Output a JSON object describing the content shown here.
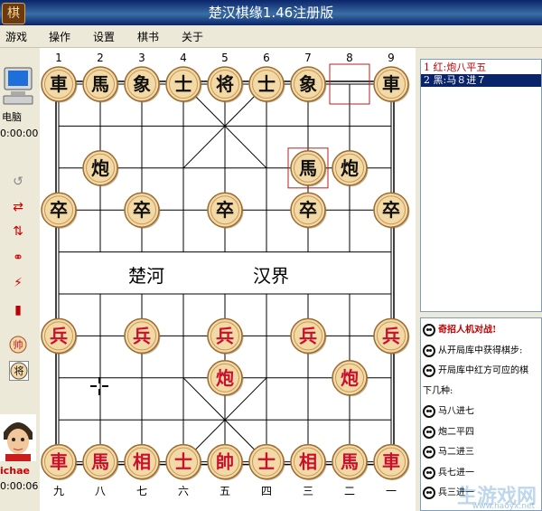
{
  "window": {
    "title": "楚汉棋缘1.46注册版",
    "icon_char": "棋"
  },
  "menu": [
    "游戏",
    "操作",
    "设置",
    "棋书",
    "关于"
  ],
  "top_player": {
    "name": "电脑",
    "time": "0:00:00"
  },
  "bottom_player": {
    "name": "ichae",
    "time": "0:00:06"
  },
  "river": {
    "left": "楚河",
    "right": "汉界"
  },
  "column_labels_top": [
    "1",
    "2",
    "3",
    "4",
    "5",
    "6",
    "7",
    "8",
    "9"
  ],
  "column_labels_bottom": [
    "九",
    "八",
    "七",
    "六",
    "五",
    "四",
    "三",
    "二",
    "一"
  ],
  "pieces": [
    {
      "c": 0,
      "r": 0,
      "ch": "車",
      "side": "black"
    },
    {
      "c": 1,
      "r": 0,
      "ch": "馬",
      "side": "black"
    },
    {
      "c": 2,
      "r": 0,
      "ch": "象",
      "side": "black"
    },
    {
      "c": 3,
      "r": 0,
      "ch": "士",
      "side": "black"
    },
    {
      "c": 4,
      "r": 0,
      "ch": "将",
      "side": "black"
    },
    {
      "c": 5,
      "r": 0,
      "ch": "士",
      "side": "black"
    },
    {
      "c": 6,
      "r": 0,
      "ch": "象",
      "side": "black"
    },
    {
      "c": 8,
      "r": 0,
      "ch": "車",
      "side": "black"
    },
    {
      "c": 1,
      "r": 2,
      "ch": "炮",
      "side": "black"
    },
    {
      "c": 6,
      "r": 2,
      "ch": "馬",
      "side": "black"
    },
    {
      "c": 7,
      "r": 2,
      "ch": "炮",
      "side": "black"
    },
    {
      "c": 0,
      "r": 3,
      "ch": "卒",
      "side": "black"
    },
    {
      "c": 2,
      "r": 3,
      "ch": "卒",
      "side": "black"
    },
    {
      "c": 4,
      "r": 3,
      "ch": "卒",
      "side": "black"
    },
    {
      "c": 6,
      "r": 3,
      "ch": "卒",
      "side": "black"
    },
    {
      "c": 8,
      "r": 3,
      "ch": "卒",
      "side": "black"
    },
    {
      "c": 0,
      "r": 6,
      "ch": "兵",
      "side": "red"
    },
    {
      "c": 2,
      "r": 6,
      "ch": "兵",
      "side": "red"
    },
    {
      "c": 4,
      "r": 6,
      "ch": "兵",
      "side": "red"
    },
    {
      "c": 6,
      "r": 6,
      "ch": "兵",
      "side": "red"
    },
    {
      "c": 8,
      "r": 6,
      "ch": "兵",
      "side": "red"
    },
    {
      "c": 4,
      "r": 7,
      "ch": "炮",
      "side": "red"
    },
    {
      "c": 7,
      "r": 7,
      "ch": "炮",
      "side": "red"
    },
    {
      "c": 0,
      "r": 9,
      "ch": "車",
      "side": "red"
    },
    {
      "c": 1,
      "r": 9,
      "ch": "馬",
      "side": "red"
    },
    {
      "c": 2,
      "r": 9,
      "ch": "相",
      "side": "red"
    },
    {
      "c": 3,
      "r": 9,
      "ch": "士",
      "side": "red"
    },
    {
      "c": 4,
      "r": 9,
      "ch": "帥",
      "side": "red"
    },
    {
      "c": 5,
      "r": 9,
      "ch": "士",
      "side": "red"
    },
    {
      "c": 6,
      "r": 9,
      "ch": "相",
      "side": "red"
    },
    {
      "c": 7,
      "r": 9,
      "ch": "馬",
      "side": "red"
    },
    {
      "c": 8,
      "r": 9,
      "ch": "車",
      "side": "red"
    }
  ],
  "last_move": {
    "from": {
      "c": 7,
      "r": 0
    },
    "to": {
      "c": 6,
      "r": 2
    }
  },
  "moves": [
    {
      "text": "1  红:炮八平五",
      "color": "#c00000",
      "selected": false
    },
    {
      "text": "2  黑:马８进７",
      "color": "#ffffff",
      "selected": true
    }
  ],
  "hints": [
    {
      "text": "奇招人机对战!",
      "icon": true,
      "color": "#c00000"
    },
    {
      "text": "从开局库中获得棋步:",
      "icon": true,
      "color": "#000000"
    },
    {
      "text": "开局库中红方可应的棋",
      "icon": true,
      "color": "#000000"
    },
    {
      "text": "下几种:",
      "icon": false,
      "color": "#000000"
    },
    {
      "text": "马八进七",
      "icon": true,
      "color": "#000000"
    },
    {
      "text": "炮二平四",
      "icon": true,
      "color": "#000000"
    },
    {
      "text": "马二进三",
      "icon": true,
      "color": "#000000"
    },
    {
      "text": "兵七进一",
      "icon": true,
      "color": "#000000"
    },
    {
      "text": "兵三进一",
      "icon": true,
      "color": "#000000"
    }
  ],
  "watermark": {
    "text": "生游戏网",
    "url": "www.haoyx.net"
  },
  "colors": {
    "red_piece": "#c8102e",
    "black_piece": "#111111",
    "piece_face": "#f3d9a6",
    "line": "#000000"
  }
}
